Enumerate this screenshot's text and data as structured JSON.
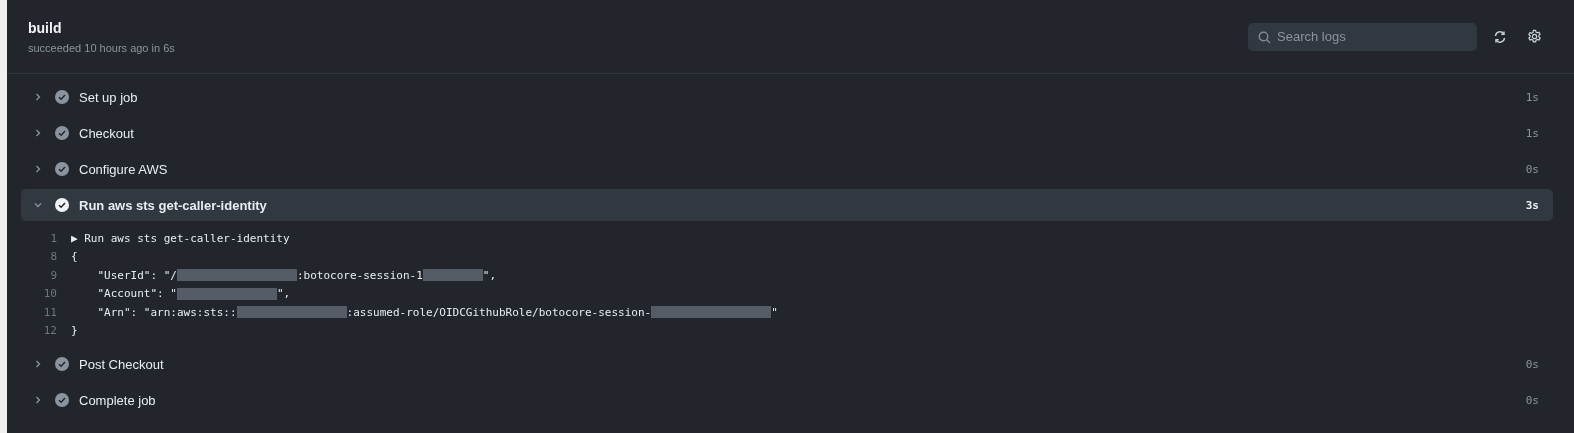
{
  "job": {
    "title": "build",
    "subtitle": "succeeded 10 hours ago in 6s"
  },
  "search": {
    "placeholder": "Search logs"
  },
  "steps": [
    {
      "name": "Set up job",
      "duration": "1s",
      "expanded": false
    },
    {
      "name": "Checkout",
      "duration": "1s",
      "expanded": false
    },
    {
      "name": "Configure AWS",
      "duration": "0s",
      "expanded": false
    },
    {
      "name": "Run aws sts get-caller-identity",
      "duration": "3s",
      "expanded": true,
      "log": [
        {
          "number": "1",
          "segments": [
            {
              "kind": "text",
              "text": "▶ Run aws sts get-caller-identity"
            }
          ]
        },
        {
          "number": "8",
          "segments": [
            {
              "kind": "text",
              "text": "{"
            }
          ]
        },
        {
          "number": "9",
          "segments": [
            {
              "kind": "text",
              "text": "    \"UserId\": \"/"
            },
            {
              "kind": "redacted"
            },
            {
              "kind": "text",
              "text": ":botocore-session-1"
            },
            {
              "kind": "redacted"
            },
            {
              "kind": "text",
              "text": "\","
            }
          ]
        },
        {
          "number": "10",
          "segments": [
            {
              "kind": "text",
              "text": "    \"Account\": \""
            },
            {
              "kind": "redacted"
            },
            {
              "kind": "text",
              "text": "\","
            }
          ]
        },
        {
          "number": "11",
          "segments": [
            {
              "kind": "text",
              "text": "    \"Arn\": \"arn:aws:sts::"
            },
            {
              "kind": "redacted"
            },
            {
              "kind": "text",
              "text": ":assumed-role/OIDCGithubRole/botocore-session-"
            },
            {
              "kind": "redacted"
            },
            {
              "kind": "text",
              "text": "\""
            }
          ]
        },
        {
          "number": "12",
          "segments": [
            {
              "kind": "text",
              "text": "}"
            }
          ]
        }
      ]
    },
    {
      "name": "Post Checkout",
      "duration": "0s",
      "expanded": false
    },
    {
      "name": "Complete job",
      "duration": "0s",
      "expanded": false
    }
  ]
}
